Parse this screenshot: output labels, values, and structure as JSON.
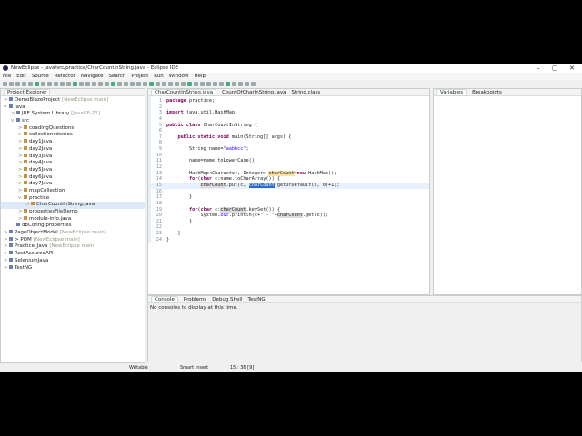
{
  "window": {
    "title": "NewEclipse - Java/src/practice/CharCountInString.java - Eclipse IDE",
    "minimize": "–",
    "maximize": "▢",
    "close": "✕"
  },
  "menu": [
    "File",
    "Edit",
    "Source",
    "Refactor",
    "Navigate",
    "Search",
    "Project",
    "Run",
    "Window",
    "Help"
  ],
  "explorer": {
    "title": "Project Explorer",
    "items": [
      {
        "label": "DemoBlazeProject",
        "tag": "[NewEclipse main]",
        "indent": 0,
        "arrow": ">"
      },
      {
        "label": "Java",
        "tag": "",
        "indent": 0,
        "arrow": "v"
      },
      {
        "label": "JRE System Library",
        "tag": "[JavaSE-21]",
        "indent": 1,
        "arrow": ">"
      },
      {
        "label": "src",
        "tag": "",
        "indent": 1,
        "arrow": "v"
      },
      {
        "label": "coadingQuestions",
        "tag": "",
        "indent": 2,
        "arrow": ">"
      },
      {
        "label": "collectionsdemos",
        "tag": "",
        "indent": 2,
        "arrow": ">"
      },
      {
        "label": "day1Java",
        "tag": "",
        "indent": 2,
        "arrow": ">"
      },
      {
        "label": "day2Java",
        "tag": "",
        "indent": 2,
        "arrow": ">"
      },
      {
        "label": "day3Java",
        "tag": "",
        "indent": 2,
        "arrow": ">"
      },
      {
        "label": "day4Java",
        "tag": "",
        "indent": 2,
        "arrow": ">"
      },
      {
        "label": "day5Java",
        "tag": "",
        "indent": 2,
        "arrow": ">"
      },
      {
        "label": "day6Java",
        "tag": "",
        "indent": 2,
        "arrow": ">"
      },
      {
        "label": "day7Java",
        "tag": "",
        "indent": 2,
        "arrow": ">"
      },
      {
        "label": "mapCollection",
        "tag": "",
        "indent": 2,
        "arrow": ">"
      },
      {
        "label": "practice",
        "tag": "",
        "indent": 2,
        "arrow": "v"
      },
      {
        "label": "CharCountInString.java",
        "tag": "",
        "indent": 3,
        "arrow": ">",
        "selected": true
      },
      {
        "label": "propertiesFileDemo",
        "tag": "",
        "indent": 2,
        "arrow": ">"
      },
      {
        "label": "module-info.java",
        "tag": "",
        "indent": 2,
        "arrow": ">"
      },
      {
        "label": "dbConfig.properties",
        "tag": "",
        "indent": 1,
        "arrow": ""
      },
      {
        "label": "PageObjectModel",
        "tag": "[NewEclipse main]",
        "indent": 0,
        "arrow": ">"
      },
      {
        "label": "> POM",
        "tag": "[NewEclipse main]",
        "indent": 0,
        "arrow": ">"
      },
      {
        "label": "Practice_Java",
        "tag": "[NewEclipse main]",
        "indent": 0,
        "arrow": ">"
      },
      {
        "label": "RestAssuredAPI",
        "tag": "",
        "indent": 0,
        "arrow": ">"
      },
      {
        "label": "SeleniumJava",
        "tag": "",
        "indent": 0,
        "arrow": ">"
      },
      {
        "label": "TestNG",
        "tag": "",
        "indent": 0,
        "arrow": ">"
      }
    ]
  },
  "editor": {
    "tabs": [
      "CharCountInString.java",
      "CountOfCharInString.java",
      "String.class"
    ],
    "lines": [
      "<span class=kw>package</span> practice;",
      "",
      "<span class=kw>import</span> java.util.HashMap;",
      "",
      "<span class=kw>public class</span> CharCountInString {",
      "",
      "    <span class=kw>public static void</span> main(String[] args) {",
      "",
      "        String name=<span class=str>\"aabbcc\"</span>;",
      "",
      "        name=name.toLowerCase();",
      "",
      "        HashMap&lt;Character, Integer&gt; <span class=ann>charCount</span>=<span class=kw>new</span> HashMap();",
      "        <span class=kw>for</span>(<span class=kw>char</span> c:name.toCharArray()) {",
      "            <span class=hl>charCount</span>.put(c, <span class=hl2>charCount</span>.getOrDefault(c, 0)+1);",
      "",
      "        }",
      "",
      "        <span class=kw>for</span>(<span class=kw>char</span> c:<span class=hl>charCount</span>.keySet()) {",
      "            System.<i class=str>out</i>.println(c+\" - \"+<span class=hl>charCount</span>.get(c));",
      "        }",
      "",
      "    }",
      "}"
    ]
  },
  "right": {
    "tabs": [
      "Variables",
      "Breakpoints"
    ]
  },
  "console": {
    "tabs": [
      "Console",
      "Problems",
      "Debug Shell",
      "TestNG"
    ],
    "message": "No consoles to display at this time."
  },
  "status": {
    "writable": "Writable",
    "insert": "Smart Insert",
    "position": "15 : 36 [9]"
  }
}
